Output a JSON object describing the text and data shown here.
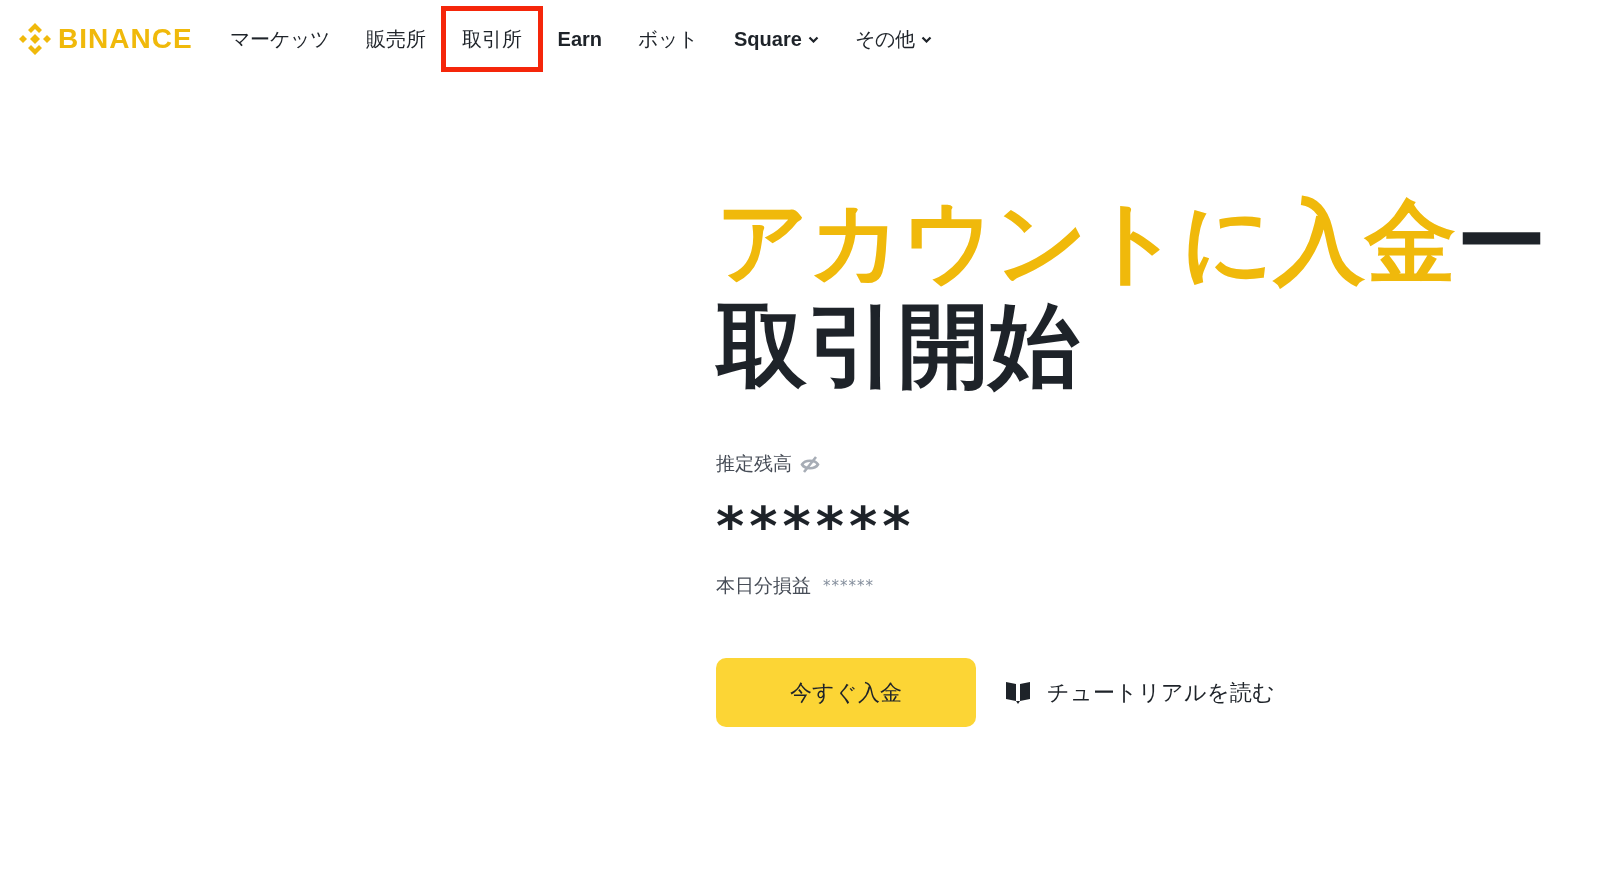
{
  "brand": {
    "name": "BINANCE"
  },
  "nav_items": [
    {
      "label": "マーケッツ",
      "kind": "link",
      "bold": false,
      "highlighted": false
    },
    {
      "label": "販売所",
      "kind": "link",
      "bold": false,
      "highlighted": false
    },
    {
      "label": "取引所",
      "kind": "link",
      "bold": false,
      "highlighted": true
    },
    {
      "label": "Earn",
      "kind": "link",
      "bold": true,
      "highlighted": false
    },
    {
      "label": "ボット",
      "kind": "link",
      "bold": false,
      "highlighted": false
    },
    {
      "label": "Square",
      "kind": "dropdown",
      "bold": true,
      "highlighted": false
    },
    {
      "label": "その他",
      "kind": "dropdown",
      "bold": false,
      "highlighted": false
    }
  ],
  "hero": {
    "title_highlight": "アカウントに入金",
    "title_rest": "ー取引開始",
    "balance_label": "推定残高",
    "balance_value": "******",
    "pnl_label": "本日分損益",
    "pnl_value": "******",
    "primary_button": "今すぐ入金",
    "tutorial_link": "チュートリアルを読む"
  }
}
